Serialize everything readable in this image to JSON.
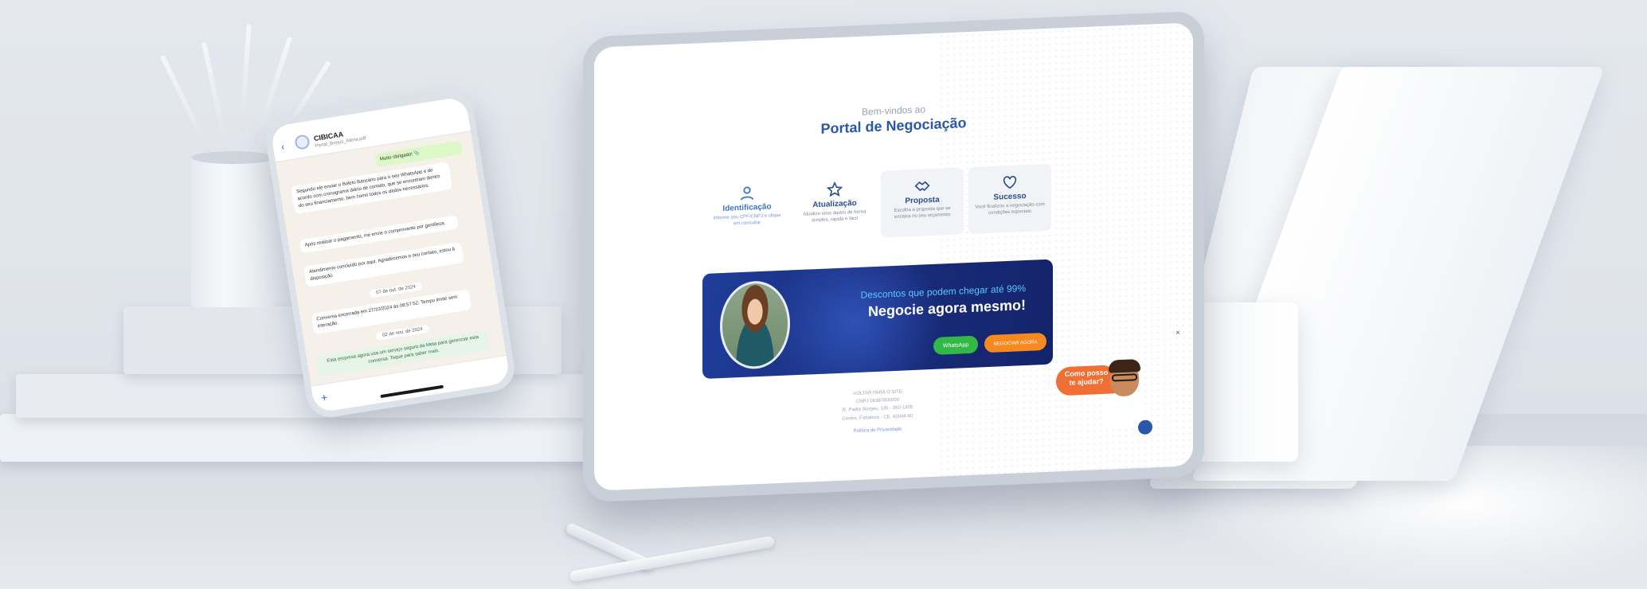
{
  "portal": {
    "welcome": "Bem-vindos ao",
    "title": "Portal de Negociação",
    "steps": [
      {
        "icon": "user-icon",
        "title": "Identificação",
        "desc": "Informe seu CPF/CNPJ e clique em consultar"
      },
      {
        "icon": "star-icon",
        "title": "Atualização",
        "desc": "Atualize seus dados de forma simples, rápida e fácil"
      },
      {
        "icon": "handshake-icon",
        "title": "Proposta",
        "desc": "Escolha a proposta que se encaixa no seu orçamento"
      },
      {
        "icon": "heart-icon",
        "title": "Sucesso",
        "desc": "Você finalizou a negociação com condições especiais"
      }
    ],
    "banner": {
      "subtitle": "Descontos que podem chegar até 99%",
      "title": "Negocie agora mesmo!",
      "whatsapp_label": "WhatsApp",
      "negotiate_label": "NEGOCIAR AGORA"
    },
    "footer": {
      "back_link": "VOLTAR PARA O SITE",
      "cnpj": "CNPJ 06387800000",
      "address1": "R. Padre Borges, 135 - 350-1305",
      "address2": "Centro, Fortaleza - CE, 60044-60",
      "privacy": "Política de Privacidade"
    },
    "assistant_bubble": [
      "Como posso",
      "te ajudar?"
    ],
    "close_label": "×"
  },
  "phone": {
    "back": "‹",
    "contact_name": "CIBICAA",
    "contact_sub": "Portal_Bonus_Atleta.pdf",
    "messages": [
      {
        "type": "out",
        "text": "Muito obrigado! 📎"
      },
      {
        "type": "in",
        "text": "Segundo ele enviar o Boleto Bancário para o seu WhatsApp e de acordo com cronograma diário de contato, que se encontram dentro do seu financiamento, bem como todos os dados necessários."
      },
      {
        "type": "in",
        "text": "Após realizar o pagamento, me envie o comprovante por gentileza."
      },
      {
        "type": "in",
        "text": "Atendimento concluído por aqui. Agradecemos o seu contato, estou à disposição."
      },
      {
        "type": "date",
        "text": "07 de out. de 2024"
      },
      {
        "type": "in",
        "text": "Conversa encerrada em 27/10/2024 às 08:57:52. Tempo limite sem interação."
      },
      {
        "type": "date",
        "text": "02 de nov. de 2024"
      },
      {
        "type": "sys",
        "text": "Esta empresa agora usa um serviço seguro da Meta para gerenciar esta conversa. Toque para saber mais."
      }
    ],
    "plus": "+"
  }
}
